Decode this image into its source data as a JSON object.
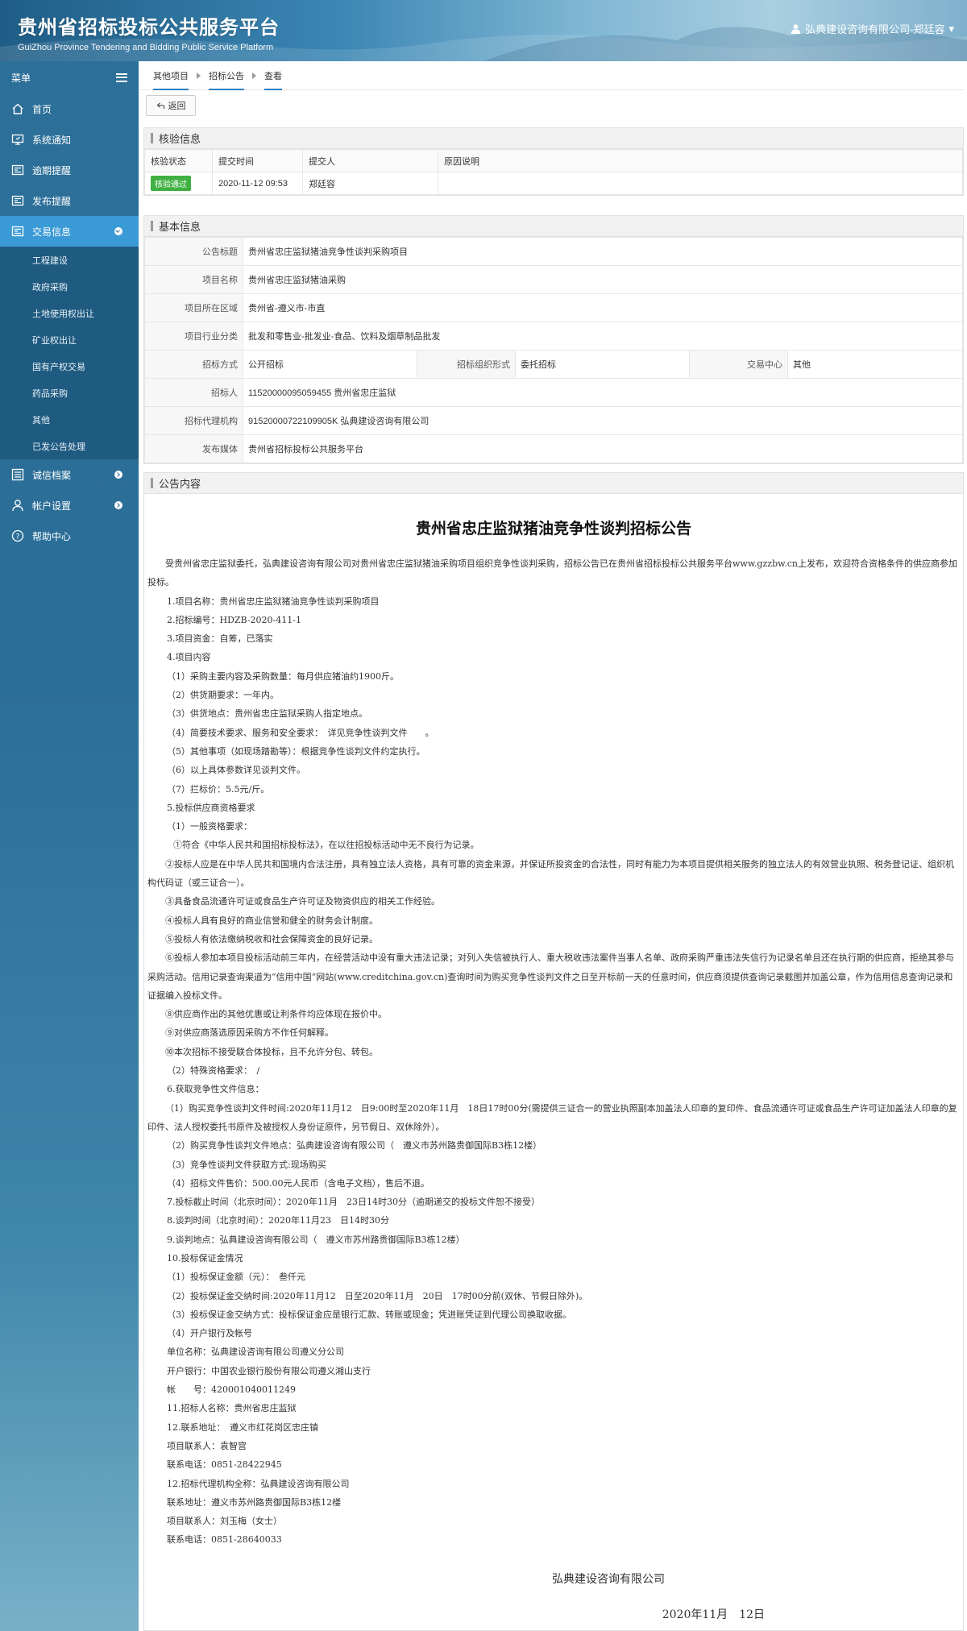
{
  "header": {
    "title_cn": "贵州省招标投标公共服务平台",
    "title_en": "GuiZhou Province Tendering and Bidding Public Service Platform",
    "user": "弘典建设咨询有限公司-郑廷容"
  },
  "sidebar": {
    "menu_label": "菜单",
    "items": [
      {
        "label": "首页",
        "icon": "home-icon"
      },
      {
        "label": "系统通知",
        "icon": "monitor-icon"
      },
      {
        "label": "逾期提醒",
        "icon": "news-icon"
      },
      {
        "label": "发布提醒",
        "icon": "news-icon"
      },
      {
        "label": "交易信息",
        "icon": "news-icon"
      }
    ],
    "subitems": [
      "工程建设",
      "政府采购",
      "土地使用权出让",
      "矿业权出让",
      "国有产权交易",
      "药品采购",
      "其他",
      "已发公告处理"
    ],
    "bottom_items": [
      {
        "label": "诚信档案",
        "icon": "list-icon"
      },
      {
        "label": "帐户设置",
        "icon": "user-icon"
      },
      {
        "label": "帮助中心",
        "icon": "help-icon"
      }
    ]
  },
  "breadcrumb": [
    "其他项目",
    "招标公告",
    "查看"
  ],
  "back_label": "返回",
  "check": {
    "title": "核验信息",
    "headers": [
      "核验状态",
      "提交时间",
      "提交人",
      "原因说明"
    ],
    "row": {
      "status": "核验通过",
      "time": "2020-11-12 09:53",
      "submitter": "郑廷容",
      "reason": ""
    }
  },
  "basic": {
    "title": "基本信息",
    "announcement_title_label": "公告标题",
    "announcement_title": "贵州省忠庄监狱猪油竞争性谈判采购项目",
    "project_name_label": "项目名称",
    "project_name": "贵州省忠庄监狱猪油采购",
    "region_label": "项目所在区域",
    "region": "贵州省-遵义市-市直",
    "industry_label": "项目行业分类",
    "industry": "批发和零售业-批发业-食品、饮料及烟草制品批发",
    "method_label": "招标方式",
    "method": "公开招标",
    "org_form_label": "招标组织形式",
    "org_form": "委托招标",
    "center_label": "交易中心",
    "center": "其他",
    "tenderer_label": "招标人",
    "tenderer": "11520000095059455 贵州省忠庄监狱",
    "agency_label": "招标代理机构",
    "agency": "91520000722109905K 弘典建设咨询有限公司",
    "media_label": "发布媒体",
    "media": "贵州省招标投标公共服务平台"
  },
  "content": {
    "title": "公告内容",
    "doc_title": "贵州省忠庄监狱猪油竞争性谈判招标公告",
    "paragraphs": [
      {
        "cls": "first",
        "text": "受贵州省忠庄监狱委托，弘典建设咨询有限公司对贵州省忠庄监狱猪油采购项目组织竞争性谈判采购，招标公告已在贵州省招标投标公共服务平台www.gzzbw.cn上发布，欢迎符合资格条件的供应商参加投标。"
      },
      {
        "cls": "ind1",
        "text": "1.项目名称：贵州省忠庄监狱猪油竞争性谈判采购项目"
      },
      {
        "cls": "ind1",
        "text": "2.招标编号：HDZB-2020-411-1"
      },
      {
        "cls": "ind1",
        "text": "3.项目资金：自筹，已落实"
      },
      {
        "cls": "ind1",
        "text": "4.项目内容"
      },
      {
        "cls": "ind1",
        "text": "（1）采购主要内容及采购数量：每月供应猪油约1900斤。"
      },
      {
        "cls": "ind1",
        "text": "（2）供货期要求：一年内。"
      },
      {
        "cls": "ind1",
        "text": "（3）供货地点：贵州省忠庄监狱采购人指定地点。"
      },
      {
        "cls": "ind1",
        "text": "（4）简要技术要求、服务和安全要求：　详见竞争性谈判文件　　。"
      },
      {
        "cls": "ind1",
        "text": "（5）其他事项（如现场踏勘等）：根据竞争性谈判文件约定执行。"
      },
      {
        "cls": "ind1",
        "text": "（6）以上具体参数详见谈判文件。"
      },
      {
        "cls": "ind1",
        "text": "（7）拦标价：5.5元/斤。"
      },
      {
        "cls": "ind1",
        "text": "5.投标供应商资格要求"
      },
      {
        "cls": "ind1",
        "text": "（1）一般资格要求："
      },
      {
        "cls": "ind2",
        "text": "①符合《中华人民共和国招标投标法》，在以往招投标活动中无不良行为记录。"
      },
      {
        "cls": "first",
        "text": "②投标人应是在中华人民共和国境内合法注册，具有独立法人资格，具有可靠的资金来源，并保证所投资金的合法性，同时有能力为本项目提供相关服务的独立法人的有效营业执照、税务登记证、组织机构代码证（或三证合一）。"
      },
      {
        "cls": "first",
        "text": "③具备食品流通许可证或食品生产许可证及物资供应的相关工作经验。"
      },
      {
        "cls": "first",
        "text": "④投标人具有良好的商业信誉和健全的财务会计制度。"
      },
      {
        "cls": "first",
        "text": "⑤投标人有依法缴纳税收和社会保障资金的良好记录。"
      },
      {
        "cls": "first",
        "text": "⑥投标人参加本项目投标活动前三年内，在经营活动中没有重大违法记录；对列入失信被执行人、重大税收违法案件当事人名单、政府采购严重违法失信行为记录名单且还在执行期的供应商，拒绝其参与采购活动。信用记录查询渠道为“信用中国”网站(www.creditchina.gov.cn)查询时间为购买竞争性谈判文件之日至开标前一天的任意时间，供应商须提供查询记录截图并加盖公章，作为信用信息查询记录和证据编入投标文件。"
      },
      {
        "cls": "first",
        "text": "⑧供应商作出的其他优惠或让利条件均应体现在报价中。"
      },
      {
        "cls": "first",
        "text": "⑨对供应商落选原因采购方不作任何解释。"
      },
      {
        "cls": "first",
        "text": "⑩本次招标不接受联合体投标，且不允许分包、转包。"
      },
      {
        "cls": "ind1",
        "text": "（2）特殊资格要求：　/"
      },
      {
        "cls": "ind1",
        "text": "6.获取竞争性文件信息："
      },
      {
        "cls": "first",
        "text": "（1）购买竞争性谈判文件时间:2020年11月12　日9:00时至2020年11月　18日17时00分(需提供三证合一的营业执照副本加盖法人印章的复印件、食品流通许可证或食品生产许可证加盖法人印章的复印件、法人授权委托书原件及被授权人身份证原件，另节假日、双休除外）。"
      },
      {
        "cls": "ind1",
        "text": "（2）购买竞争性谈判文件地点：弘典建设咨询有限公司（　遵义市苏州路贵御国际B3栋12楼）"
      },
      {
        "cls": "ind1",
        "text": "（3）竞争性谈判文件获取方式:现场购买"
      },
      {
        "cls": "ind1",
        "text": "（4）招标文件售价：500.00元人民币（含电子文档），售后不退。"
      },
      {
        "cls": "ind1",
        "text": "7.投标截止时间（北京时间）：2020年11月　23日14时30分（逾期递交的投标文件恕不接受）"
      },
      {
        "cls": "ind1",
        "text": "8.谈判时间（北京时间）：2020年11月23　日14时30分"
      },
      {
        "cls": "ind1",
        "text": "9.谈判地点：弘典建设咨询有限公司（　遵义市苏州路贵御国际B3栋12楼）"
      },
      {
        "cls": "ind1",
        "text": "10.投标保证金情况"
      },
      {
        "cls": "ind1",
        "text": "（1）投标保证金额（元）：　叁仟元"
      },
      {
        "cls": "ind1",
        "text": "（2）投标保证金交纳时间:2020年11月12　日至2020年11月　20日　17时00分前(双休、节假日除外)。"
      },
      {
        "cls": "ind1",
        "text": "（3）投标保证金交纳方式：投标保证金应是银行汇款、转账或现金；凭进账凭证到代理公司换取收据。"
      },
      {
        "cls": "ind1",
        "text": "（4）开户银行及帐号"
      },
      {
        "cls": "ind1",
        "text": "单位名称：弘典建设咨询有限公司遵义分公司"
      },
      {
        "cls": "ind1",
        "text": "开户银行：中国农业银行股份有限公司遵义湘山支行"
      },
      {
        "cls": "ind1",
        "text": "帐　　号：420001040011249"
      },
      {
        "cls": "ind1",
        "text": "11.招标人名称：贵州省忠庄监狱"
      },
      {
        "cls": "ind1",
        "text": "12.联系地址：　遵义市红花岗区忠庄镇"
      },
      {
        "cls": "ind1",
        "text": "项目联系人：袁智宫"
      },
      {
        "cls": "ind1",
        "text": "联系电话：0851-28422945"
      },
      {
        "cls": "ind1",
        "text": "12.招标代理机构全称：弘典建设咨询有限公司"
      },
      {
        "cls": "ind1",
        "text": "联系地址：遵义市苏州路贵御国际B3栋12楼"
      },
      {
        "cls": "ind1",
        "text": "项目联系人：刘玉梅（女士）"
      },
      {
        "cls": "ind1",
        "text": "联系电话：0851-28640033"
      }
    ],
    "sign_company": "弘典建设咨询有限公司",
    "sign_date": "2020年11月　12日"
  }
}
